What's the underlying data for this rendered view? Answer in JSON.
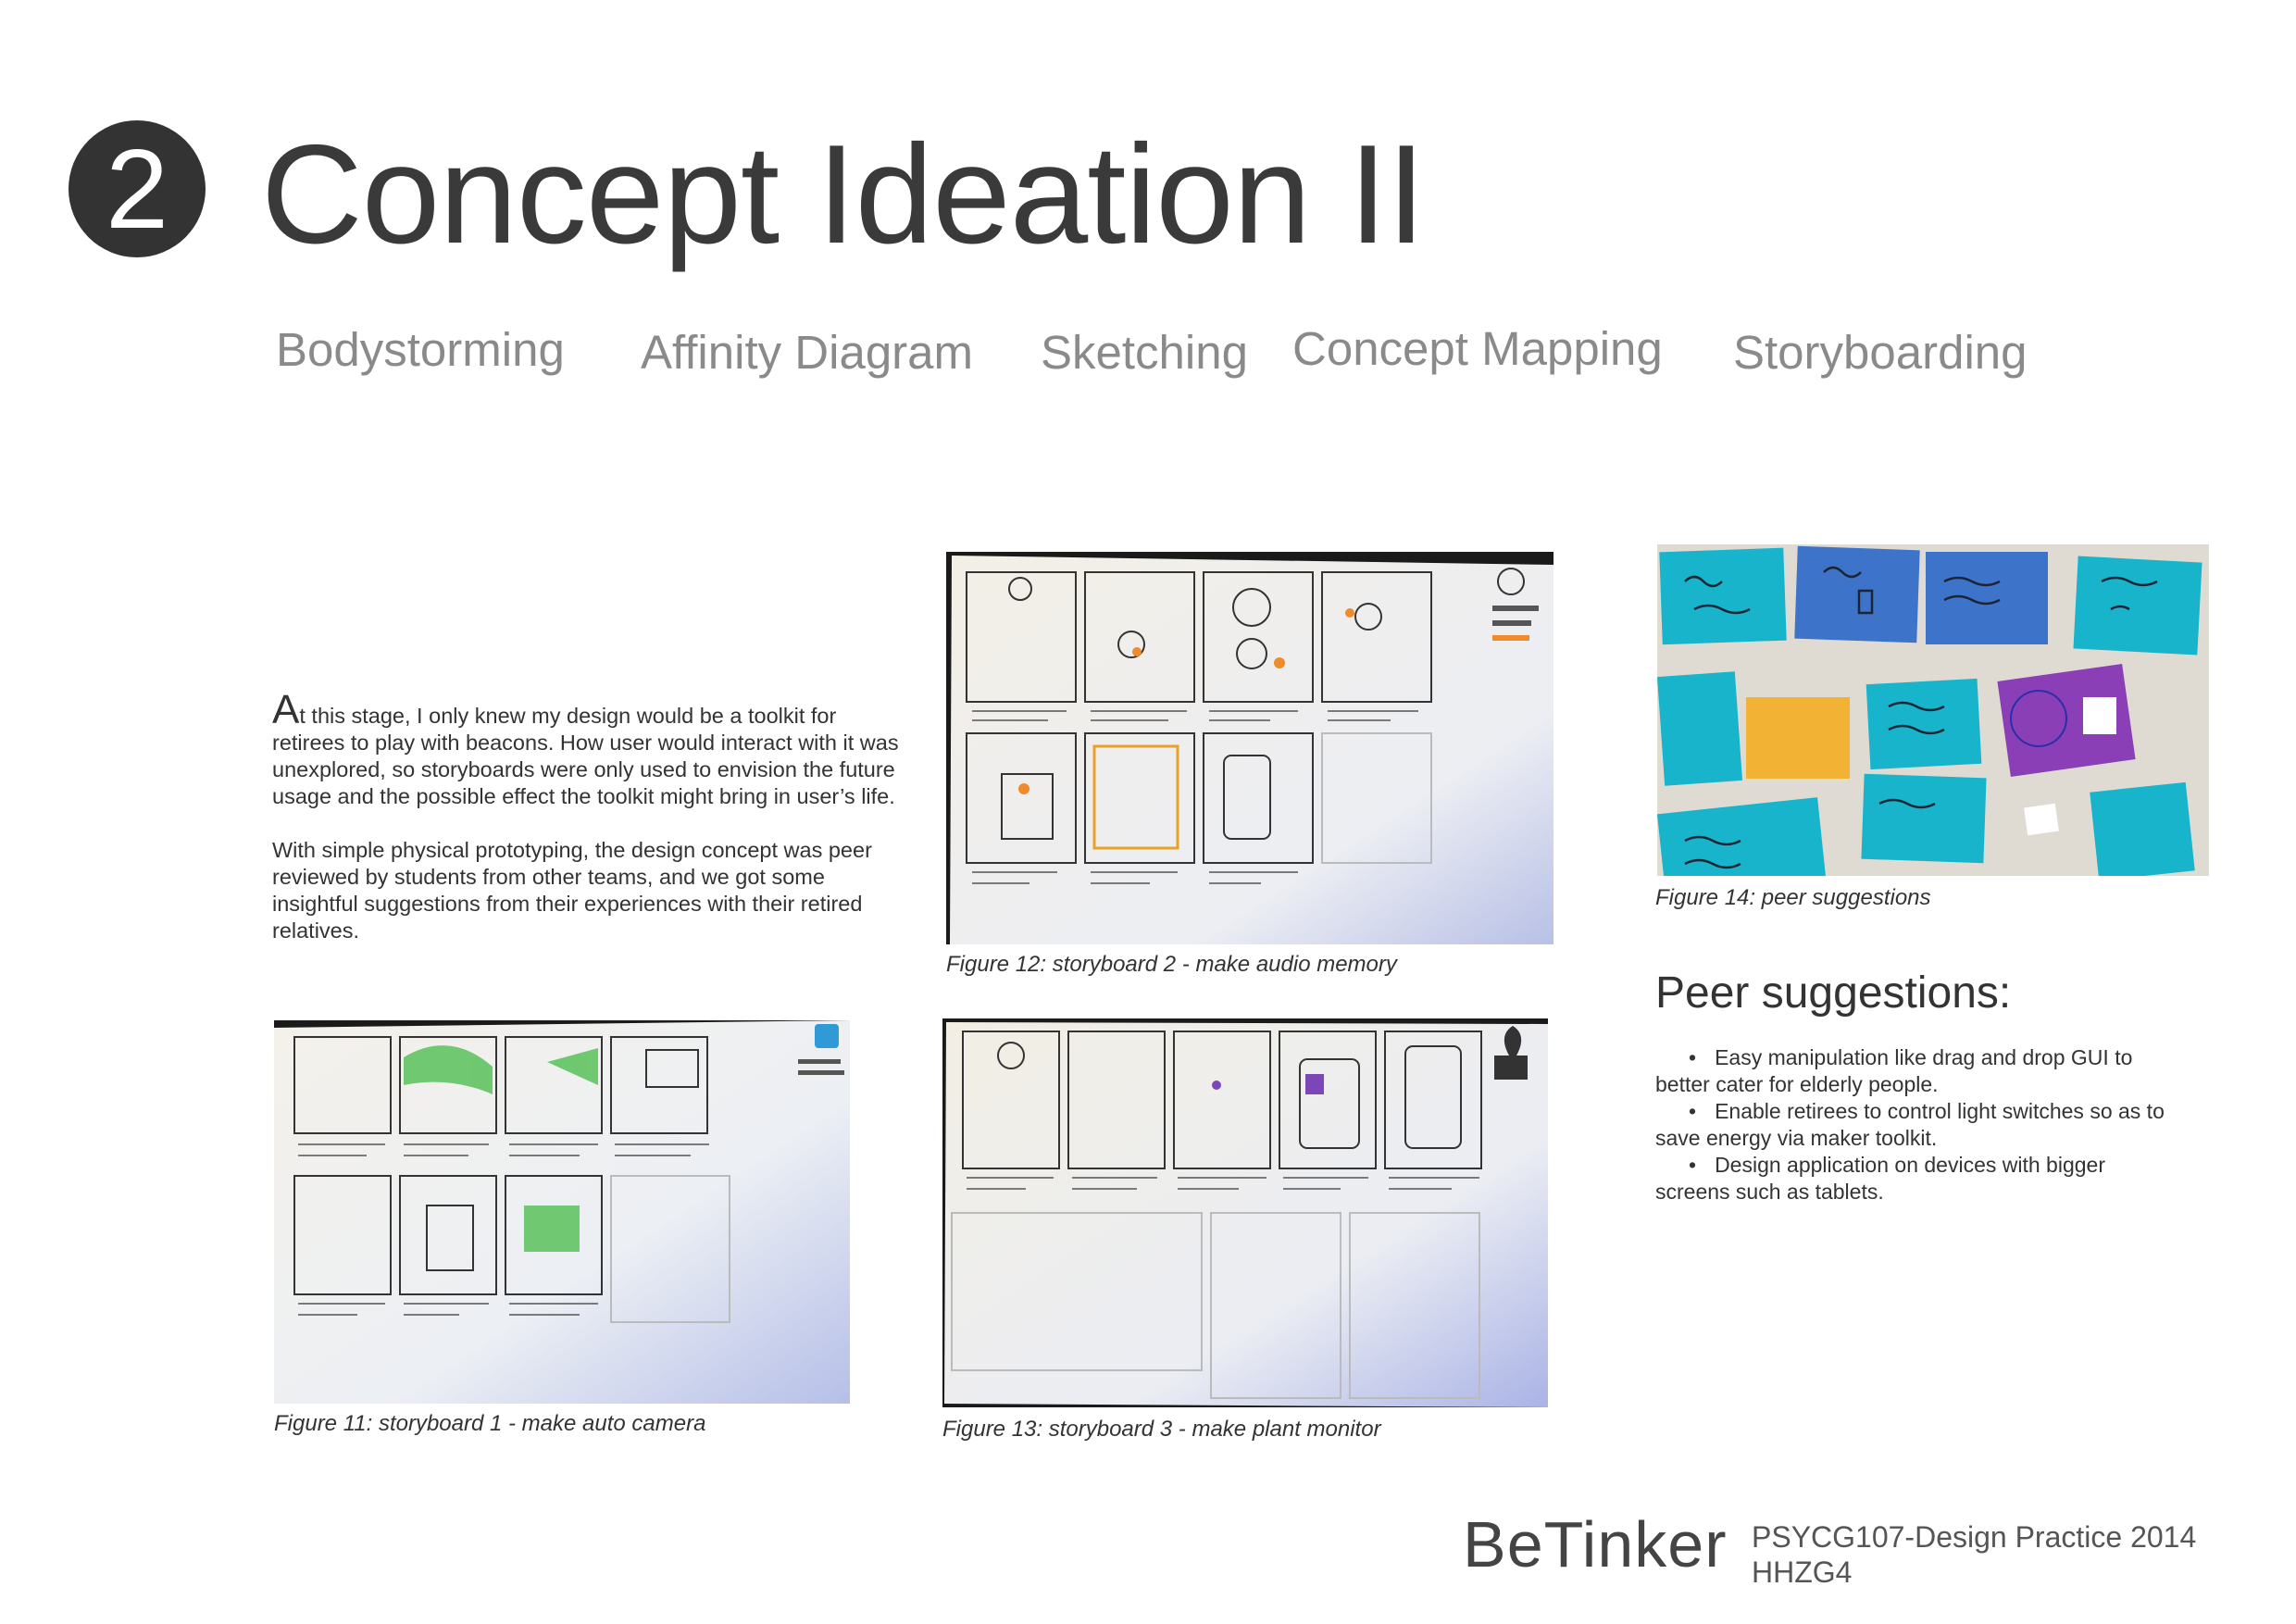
{
  "header": {
    "section_number": "2",
    "title": "Concept Ideation II"
  },
  "methods": [
    "Bodystorming",
    "Affinity Diagram",
    "Sketching",
    "Concept Mapping",
    "Storyboarding"
  ],
  "intro": {
    "dropcap": "A",
    "para1_rest": "t this stage, I only knew my design would be a toolkit for retirees to play with beacons. How user would interact with it was unexplored, so storyboards were only used to envision the future usage and the possible effect the toolkit might bring in user’s life.",
    "para2": "With simple physical prototyping, the design concept was peer reviewed by students from other teams, and we got some insightful suggestions from their experiences with their retired relatives."
  },
  "figures": {
    "fig11": "Figure 11: storyboard 1 - make auto camera",
    "fig12": "Figure 12: storyboard 2 - make audio memory",
    "fig13": "Figure 13: storyboard 3 - make plant monitor",
    "fig14": "Figure 14: peer suggestions"
  },
  "peer": {
    "title": "Peer suggestions:",
    "items": [
      "Easy manipulation like drag and drop GUI to better cater for elderly people.",
      "Enable retirees to control light switches so as to save energy via maker toolkit.",
      "Design application on devices with bigger screens such as tablets."
    ]
  },
  "footer": {
    "brand": "BeTinker",
    "course": "PSYCG107-Design Practice 2014",
    "group": "HHZG4"
  },
  "colors": {
    "text_dark": "#333333",
    "tab_gray": "#8a8a8a",
    "sticky_teal": "#19b6cc",
    "sticky_blue": "#3f74c9",
    "sticky_purple": "#8a3fb6",
    "sticky_orange": "#f2b233",
    "board_gray": "#dcd6cc"
  }
}
